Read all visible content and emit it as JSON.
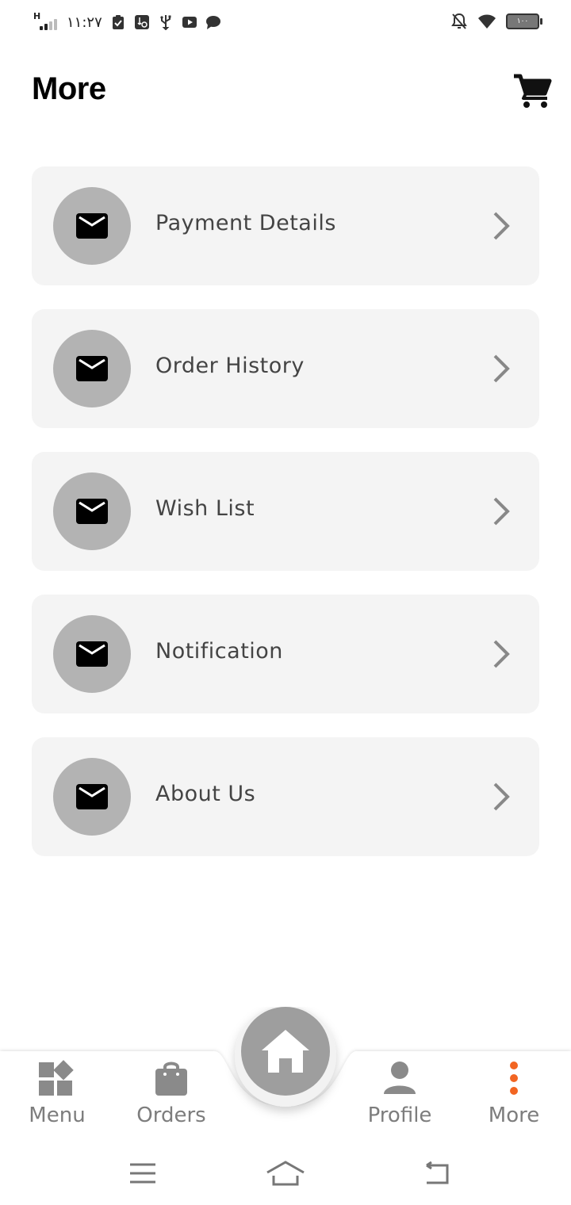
{
  "status_bar": {
    "network_label": "H",
    "time": "١١:٢٧",
    "battery": "١٠٠"
  },
  "header": {
    "title": "More"
  },
  "menu": {
    "items": [
      {
        "label": "Payment Details",
        "icon": "mail-icon"
      },
      {
        "label": "Order History",
        "icon": "mail-icon"
      },
      {
        "label": "Wish List",
        "icon": "mail-icon"
      },
      {
        "label": "Notification",
        "icon": "mail-icon"
      },
      {
        "label": "About Us",
        "icon": "mail-icon"
      }
    ]
  },
  "bottom_nav": {
    "items": [
      {
        "label": "Menu",
        "icon": "grid-icon",
        "active": false
      },
      {
        "label": "Orders",
        "icon": "shopping-bag-icon",
        "active": false
      },
      {
        "label": "Profile",
        "icon": "person-icon",
        "active": false
      },
      {
        "label": "More",
        "icon": "more-vertical-icon",
        "active": true
      }
    ],
    "center_icon": "home-icon"
  },
  "colors": {
    "accent": "#f26522",
    "card_bg": "#f4f4f4",
    "icon_circle": "#b3b3b3",
    "nav_inactive": "#7d7d7d",
    "fab": "#9e9e9e"
  }
}
